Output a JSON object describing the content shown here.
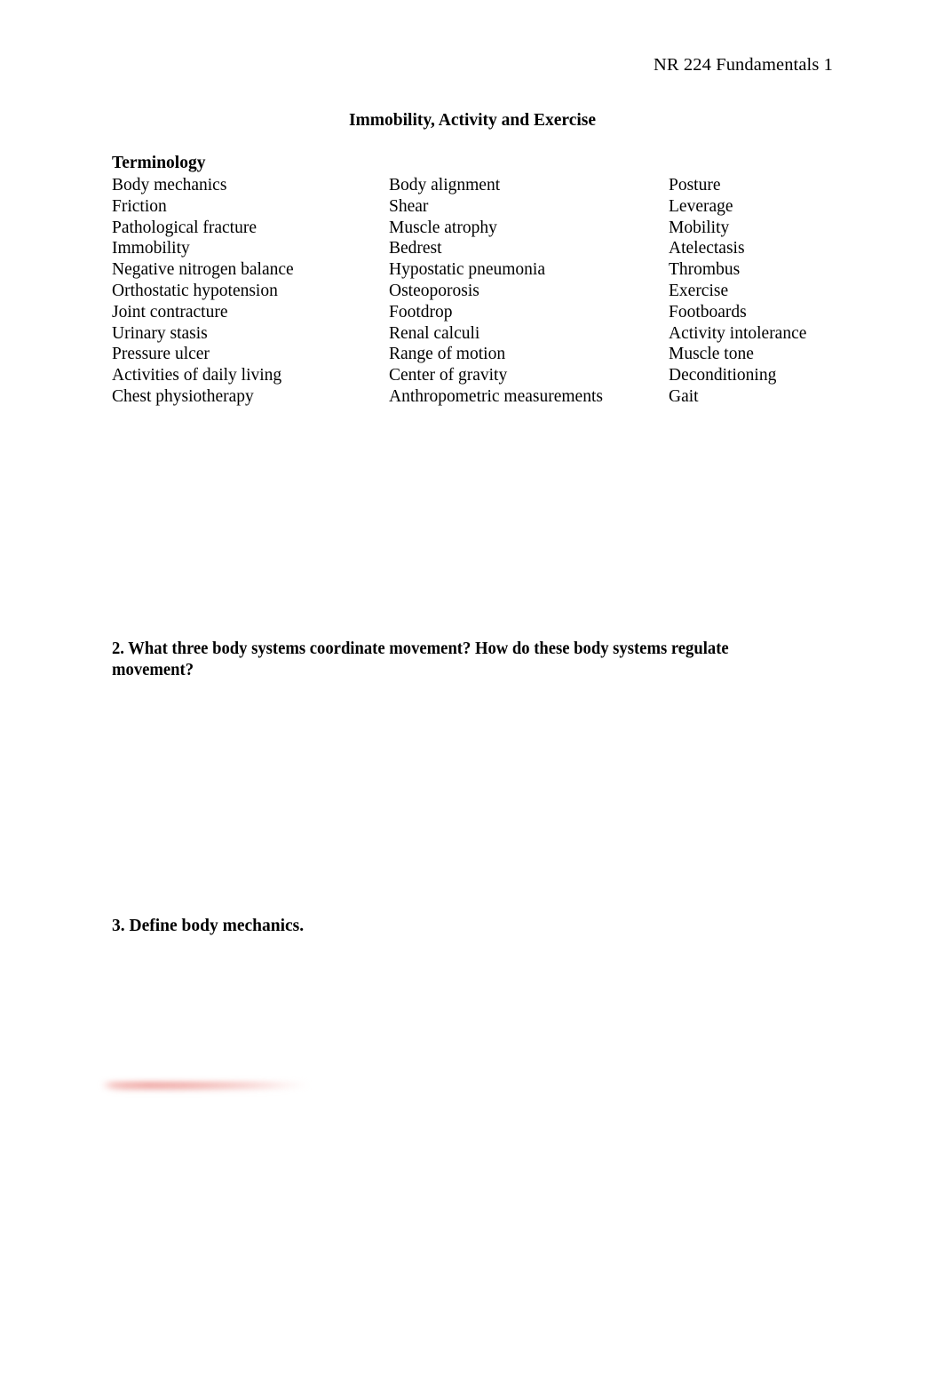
{
  "header": {
    "running_head": "NR 224 Fundamentals 1"
  },
  "title": "Immobility, Activity and Exercise",
  "terminology": {
    "heading": "Terminology",
    "rows": [
      [
        "Body mechanics",
        "Body alignment",
        "Posture"
      ],
      [
        "Friction",
        "Shear",
        "Leverage"
      ],
      [
        "Pathological fracture",
        "Muscle atrophy",
        "Mobility"
      ],
      [
        "Immobility",
        "Bedrest",
        "Atelectasis"
      ],
      [
        "Negative nitrogen balance",
        "Hypostatic pneumonia",
        "Thrombus"
      ],
      [
        "Orthostatic hypotension",
        "Osteoporosis",
        "Exercise"
      ],
      [
        "Joint contracture",
        "Footdrop",
        "Footboards"
      ],
      [
        "Urinary stasis",
        "Renal calculi",
        "Activity intolerance"
      ],
      [
        "Pressure ulcer",
        "Range of motion",
        "Muscle tone"
      ],
      [
        "Activities of daily living",
        "Center of gravity",
        "Deconditioning"
      ],
      [
        "Chest physiotherapy",
        "Anthropometric measurements",
        "Gait"
      ]
    ]
  },
  "questions": {
    "q2": "2. What three body systems coordinate movement? How do these body systems regulate movement?",
    "q3": "3. Define body mechanics."
  },
  "annotations": {
    "smear_color": "#eb8782"
  }
}
